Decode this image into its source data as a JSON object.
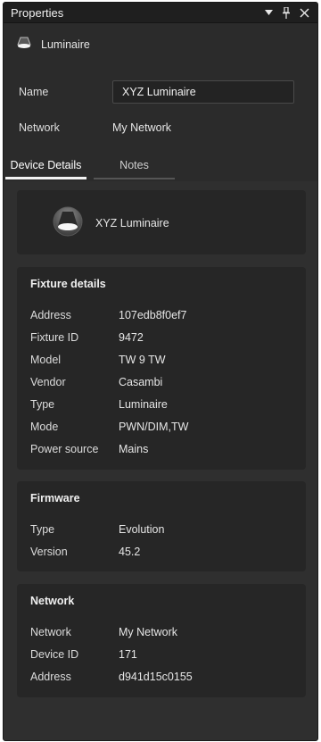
{
  "panel": {
    "title": "Properties",
    "controls": [
      "dropdown-icon",
      "pin-icon",
      "close-icon"
    ]
  },
  "header": {
    "device_label": "Luminaire"
  },
  "fields": {
    "name_label": "Name",
    "name_value": "XYZ Luminaire",
    "network_label": "Network",
    "network_value": "My Network"
  },
  "tabs": [
    {
      "label": "Device Details",
      "active": true
    },
    {
      "label": "Notes",
      "active": false
    }
  ],
  "device_card": {
    "name": "XYZ Luminaire"
  },
  "fixture": {
    "title": "Fixture details",
    "rows": [
      {
        "key": "Address",
        "value": "107edb8f0ef7"
      },
      {
        "key": "Fixture ID",
        "value": "9472"
      },
      {
        "key": "Model",
        "value": "TW 9 TW"
      },
      {
        "key": "Vendor",
        "value": "Casambi"
      },
      {
        "key": "Type",
        "value": "Luminaire"
      },
      {
        "key": "Mode",
        "value": "PWN/DIM,TW"
      },
      {
        "key": "Power source",
        "value": "Mains"
      }
    ]
  },
  "firmware": {
    "title": "Firmware",
    "rows": [
      {
        "key": "Type",
        "value": "Evolution"
      },
      {
        "key": "Version",
        "value": "45.2"
      }
    ]
  },
  "network": {
    "title": "Network",
    "rows": [
      {
        "key": "Network",
        "value": "My Network"
      },
      {
        "key": "Device ID",
        "value": "171"
      },
      {
        "key": "Address",
        "value": "d941d15c0155"
      }
    ]
  },
  "colors": {
    "panel_bg": "#2b2b2b",
    "card_bg": "#262626",
    "titlebar_bg": "#1f1f1f",
    "text": "#e6e6e6"
  }
}
